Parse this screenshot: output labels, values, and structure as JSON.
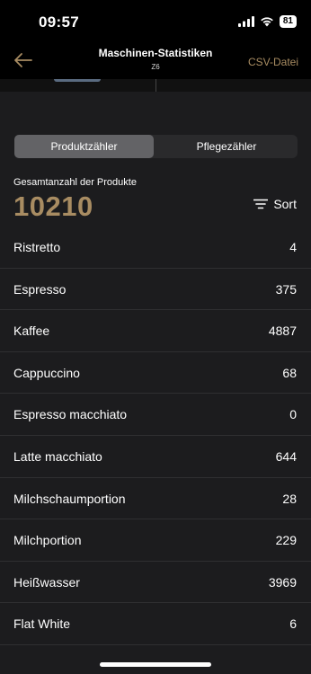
{
  "status_bar": {
    "time": "09:57",
    "battery": "81"
  },
  "nav": {
    "title": "Maschinen-Statistiken",
    "subtitle": "Z6",
    "csv_label": "CSV-Datei",
    "accent": "#a88c62"
  },
  "tabs": [
    {
      "label": "Produktzähler",
      "active": true
    },
    {
      "label": "Pflegezähler",
      "active": false
    }
  ],
  "total": {
    "label": "Gesamtanzahl der Produkte",
    "value": "10210"
  },
  "sort": {
    "label": "Sort",
    "icon": "sort-icon"
  },
  "products": [
    {
      "name": "Ristretto",
      "count": "4"
    },
    {
      "name": "Espresso",
      "count": "375"
    },
    {
      "name": "Kaffee",
      "count": "4887"
    },
    {
      "name": "Cappuccino",
      "count": "68"
    },
    {
      "name": "Espresso macchiato",
      "count": "0"
    },
    {
      "name": "Latte macchiato",
      "count": "644"
    },
    {
      "name": "Milchschaumportion",
      "count": "28"
    },
    {
      "name": "Milchportion",
      "count": "229"
    },
    {
      "name": "Heißwasser",
      "count": "3969"
    },
    {
      "name": "Flat White",
      "count": "6"
    }
  ]
}
